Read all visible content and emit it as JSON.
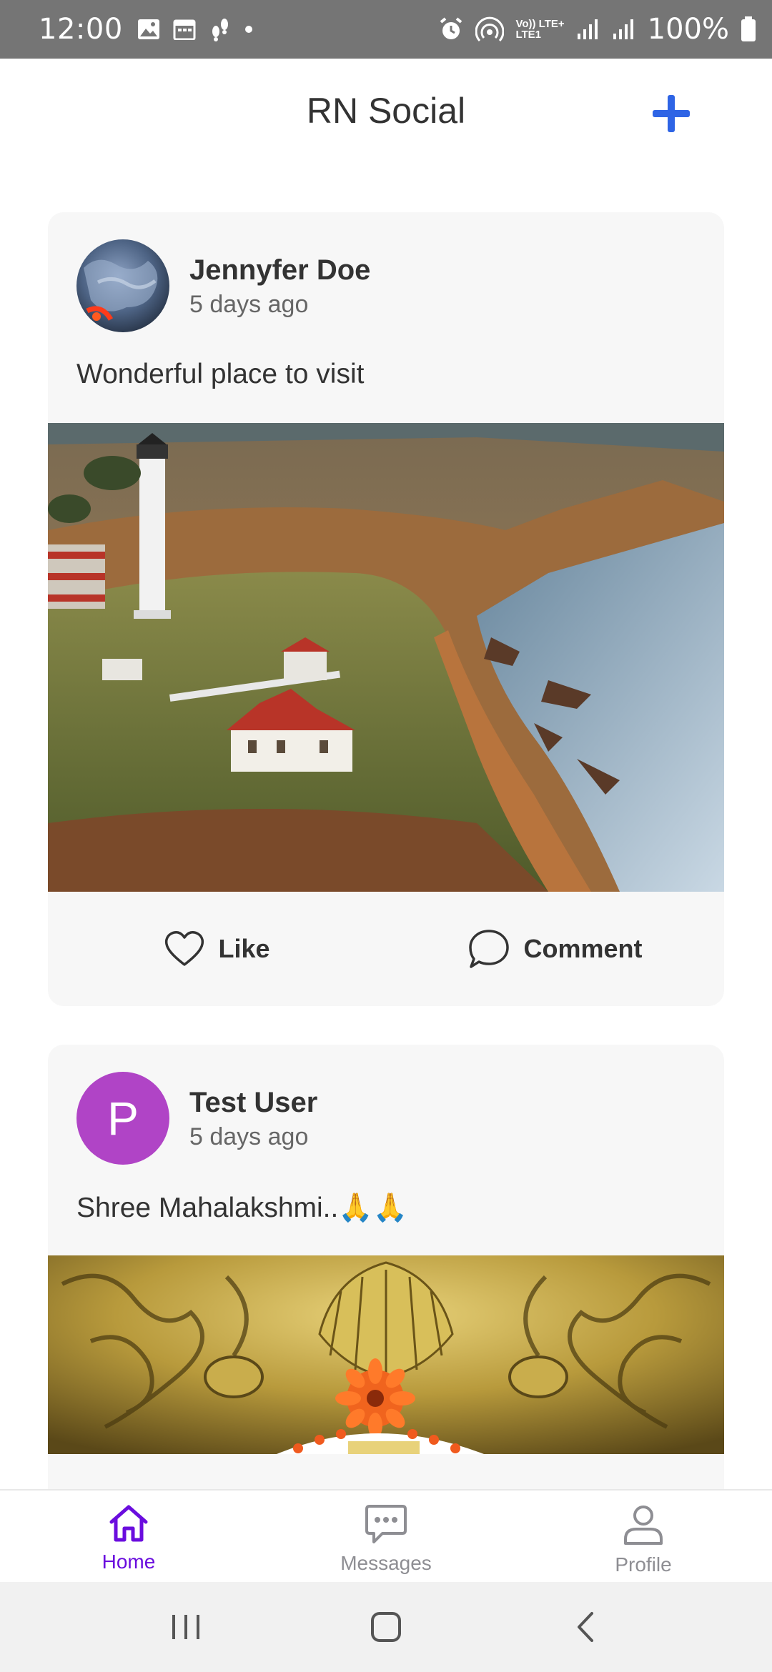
{
  "status_bar": {
    "time": "12:00",
    "battery": "100%",
    "network_top": "Vo)) LTE+",
    "network_bottom": "LTE1"
  },
  "header": {
    "title": "RN Social",
    "add_icon": "plus-icon"
  },
  "posts": [
    {
      "user_name": "Jennyfer Doe",
      "time": "5 days ago",
      "text": "Wonderful place to visit",
      "like_label": "Like",
      "comment_label": "Comment"
    },
    {
      "user_name": "Test User",
      "avatar_letter": "P",
      "time": "5 days ago",
      "text": "Shree Mahalakshmi..🙏🙏"
    }
  ],
  "bottom_nav": {
    "items": [
      {
        "label": "Home",
        "icon": "home-icon",
        "active": true
      },
      {
        "label": "Messages",
        "icon": "chat-icon",
        "active": false
      },
      {
        "label": "Profile",
        "icon": "person-icon",
        "active": false
      }
    ]
  },
  "colors": {
    "accent": "#2e64e5",
    "active_tab": "#6a0dde",
    "inactive_tab": "#8e8e93",
    "card_bg": "#f7f7f7",
    "avatar_p": "#b044c6"
  }
}
